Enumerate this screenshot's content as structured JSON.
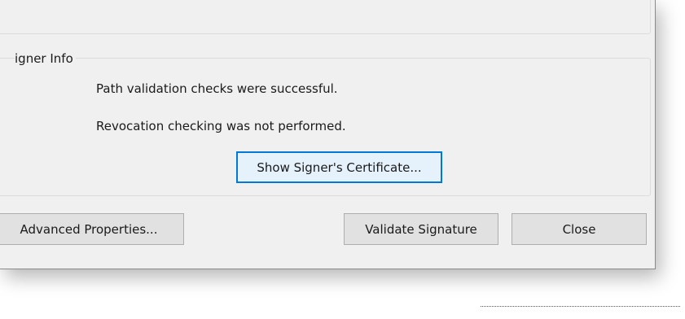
{
  "signer_info": {
    "legend": "igner Info",
    "path_validation": "Path validation checks were successful.",
    "revocation": "Revocation checking was not performed.",
    "show_certificate_label": "Show Signer's Certificate..."
  },
  "footer_buttons": {
    "advanced_properties_label": "Advanced Properties...",
    "validate_signature_label": "Validate Signature",
    "close_label": "Close"
  },
  "colors": {
    "dialog_background": "#f0f0f0",
    "button_background": "#e1e1e1",
    "focus_border": "#0078d7"
  }
}
